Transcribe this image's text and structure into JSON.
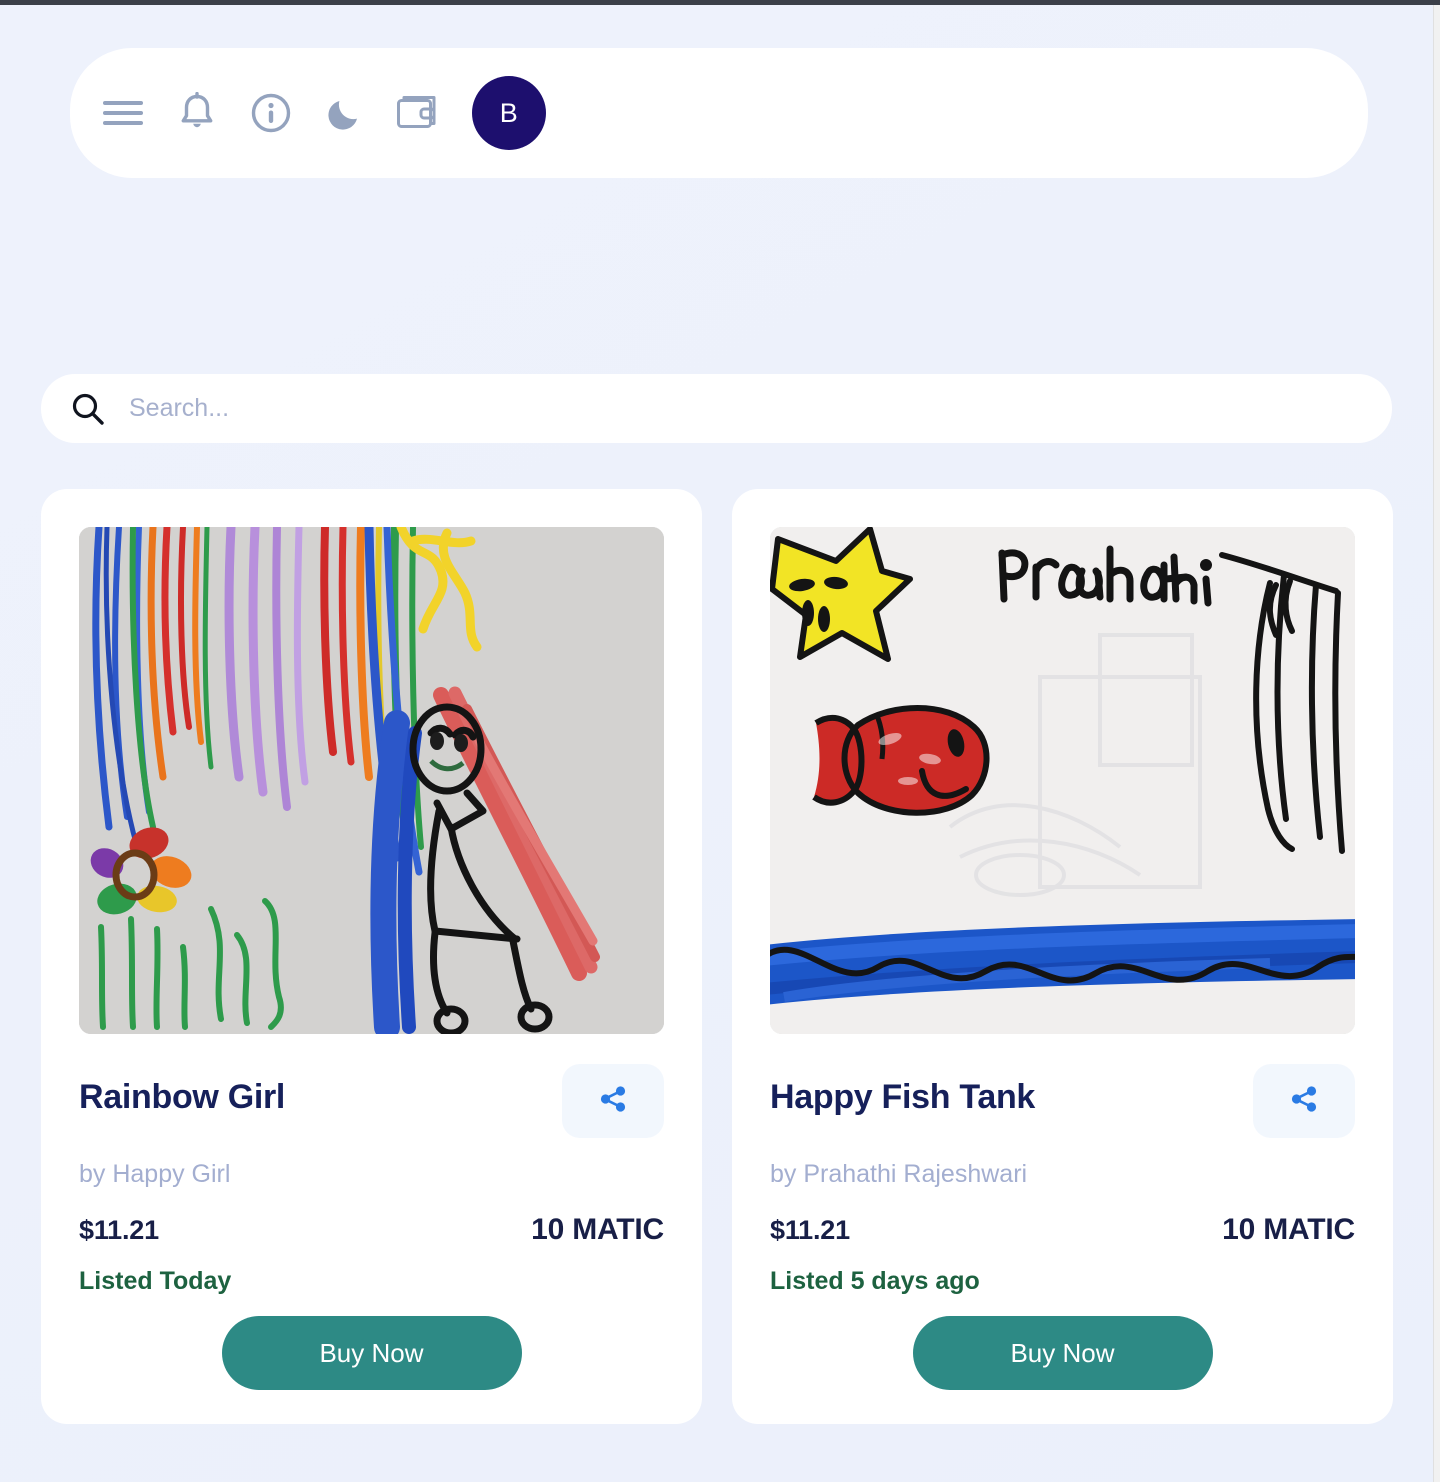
{
  "header": {
    "icons": [
      {
        "name": "menu-icon",
        "label": "Menu"
      },
      {
        "name": "bell-icon",
        "label": "Notifications"
      },
      {
        "name": "info-icon",
        "label": "Info"
      },
      {
        "name": "moon-icon",
        "label": "Dark mode"
      },
      {
        "name": "wallet-icon",
        "label": "Wallet"
      }
    ],
    "avatar_initial": "B",
    "avatar_color": "#1D0F6E"
  },
  "search": {
    "placeholder": "Search...",
    "value": "",
    "icon": "search-icon"
  },
  "colors": {
    "page_background": "#EDF1FB",
    "card_background": "#FFFFFF",
    "title": "#16205A",
    "author": "#A3AED0",
    "price": "#181F47",
    "listed": "#1D6240",
    "buy_button": "#2D8A85",
    "share_icon": "#2A7BE4",
    "share_button_background": "#F2F7FD",
    "header_icon": "#94A3BE"
  },
  "cards": [
    {
      "title": "Rainbow Girl",
      "author": "by Happy Girl",
      "price_usd": "$11.21",
      "price_token": "10 MATIC",
      "listed": "Listed Today",
      "buy_label": "Buy Now",
      "share_icon": "share-icon",
      "artwork": "rainbow-girl-drawing"
    },
    {
      "title": "Happy Fish Tank",
      "author": "by Prahathi Rajeshwari",
      "price_usd": "$11.21",
      "price_token": "10 MATIC",
      "listed": "Listed 5 days ago",
      "buy_label": "Buy Now",
      "share_icon": "share-icon",
      "artwork": "happy-fish-tank-drawing",
      "artwork_text": "Prahathi"
    }
  ]
}
